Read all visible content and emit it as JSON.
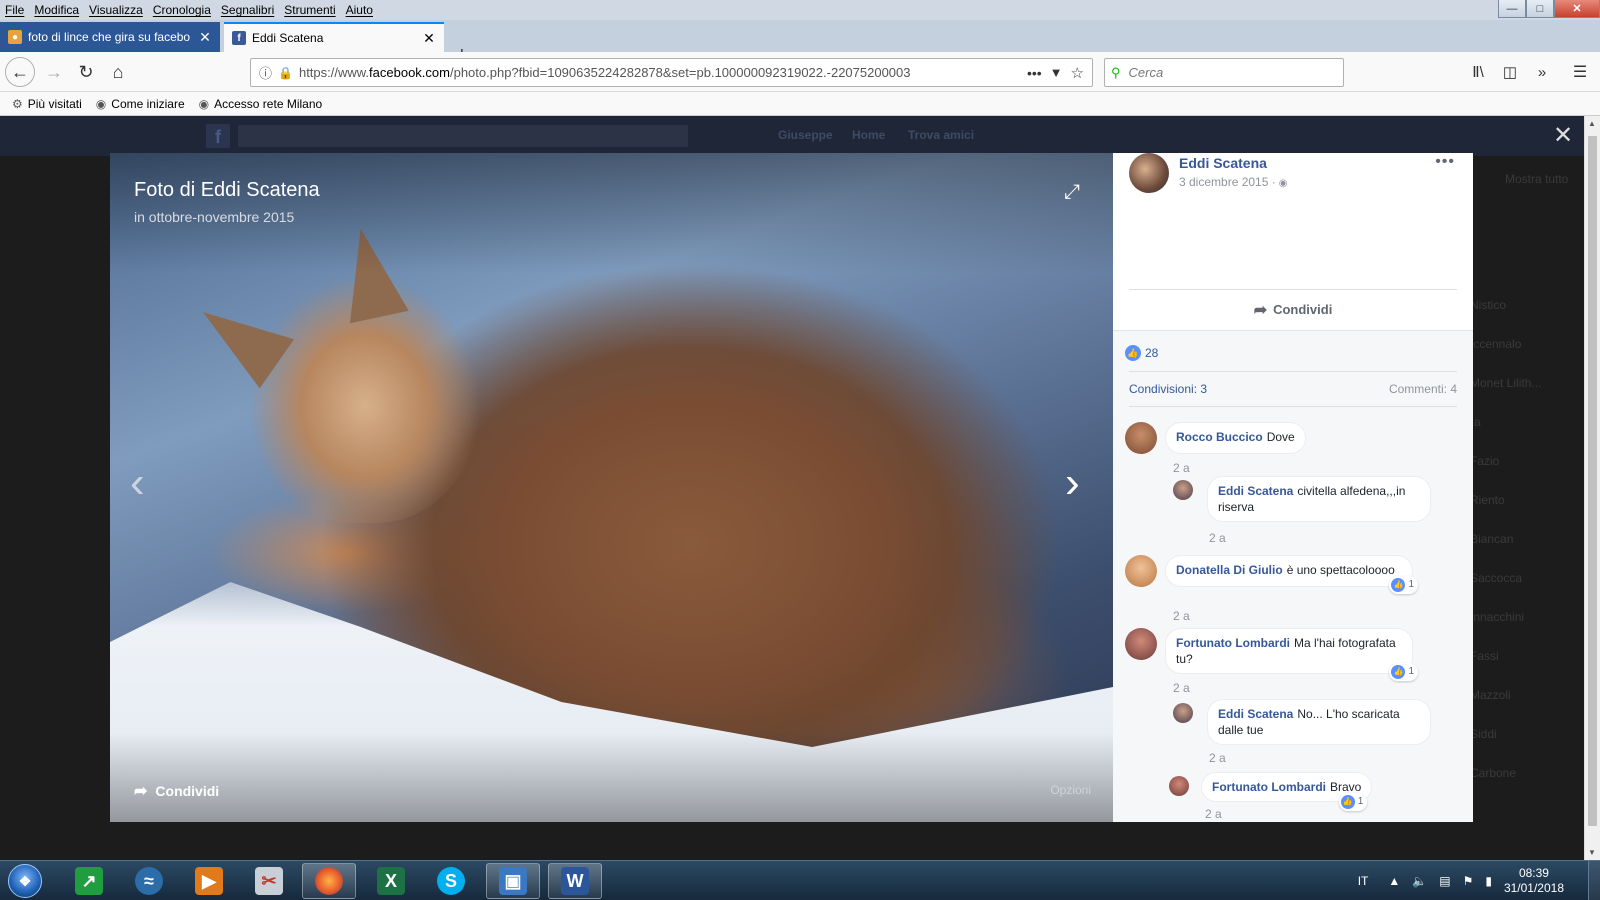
{
  "menu": [
    "File",
    "Modifica",
    "Visualizza",
    "Cronologia",
    "Segnalibri",
    "Strumenti",
    "Aiuto"
  ],
  "tabs": [
    {
      "title": "foto di lince che gira su facebo",
      "favicon": "search-favicon",
      "active": false
    },
    {
      "title": "Eddi Scatena",
      "favicon": "facebook-favicon",
      "active": true
    }
  ],
  "nav": {
    "url_prefix": "https://www.",
    "url_domain": "facebook.com",
    "url_rest": "/photo.php?fbid=1090635224282878&set=pb.100000092319022.-22075200003",
    "search_placeholder": "Cerca"
  },
  "bookmarks": [
    "Più visitati",
    "Come iniziare",
    "Accesso rete Milano"
  ],
  "fb_topbar": {
    "logo": "f",
    "links": [
      "Giuseppe",
      "Home",
      "Trova amici"
    ]
  },
  "photo": {
    "title": "Foto di Eddi Scatena",
    "subtitle": "in ottobre-novembre 2015",
    "share_label": "Condividi",
    "options_label": "Opzioni"
  },
  "post": {
    "author": "Eddi Scatena",
    "date": "3 dicembre 2015 ·",
    "share_label": "Condividi",
    "likes": "28",
    "shares": "Condivisioni: 3",
    "comments_count": "Commenti: 4"
  },
  "comments": [
    {
      "author": "Rocco Buccico",
      "text": "Dove",
      "time": "2 a",
      "reactions": ""
    },
    {
      "author": "Eddi Scatena",
      "text": "civitella alfedena,,,in riserva",
      "time": "2 a",
      "reactions": ""
    },
    {
      "author": "Donatella Di Giulio",
      "text": "è uno spettacoloooo",
      "time": "2 a",
      "reactions": "1"
    },
    {
      "author": "Fortunato Lombardi",
      "text": "Ma l'hai fotografata tu?",
      "time": "2 a",
      "reactions": "1"
    },
    {
      "author": "Eddi Scatena",
      "text": "No... L'ho scaricata dalle tue",
      "time": "2 a",
      "reactions": ""
    },
    {
      "author": "Fortunato Lombardi",
      "text": "Bravo",
      "time": "2 a",
      "reactions": "1"
    }
  ],
  "background_right": {
    "header": "Mostra tutto",
    "items": [
      "Nistico",
      "Iccennalo",
      "Monet Lilith...",
      "ra",
      "Fazio",
      "Riento",
      "Biancan",
      "Saccocca",
      "Innacchini",
      "Fassi",
      "Mazzoli",
      "Siddi",
      "Carbone"
    ]
  },
  "taskbar": {
    "apps": [
      "stocks-app",
      "wifi-app",
      "media-player",
      "snipping-tool",
      "firefox",
      "excel",
      "skype",
      "remote-desktop",
      "word"
    ],
    "lang": "IT",
    "time": "08:39",
    "date": "31/01/2018"
  },
  "colors": {
    "fb_blue": "#365899",
    "like_blue": "#5890ff",
    "tab_active_accent": "#0a84ff"
  }
}
